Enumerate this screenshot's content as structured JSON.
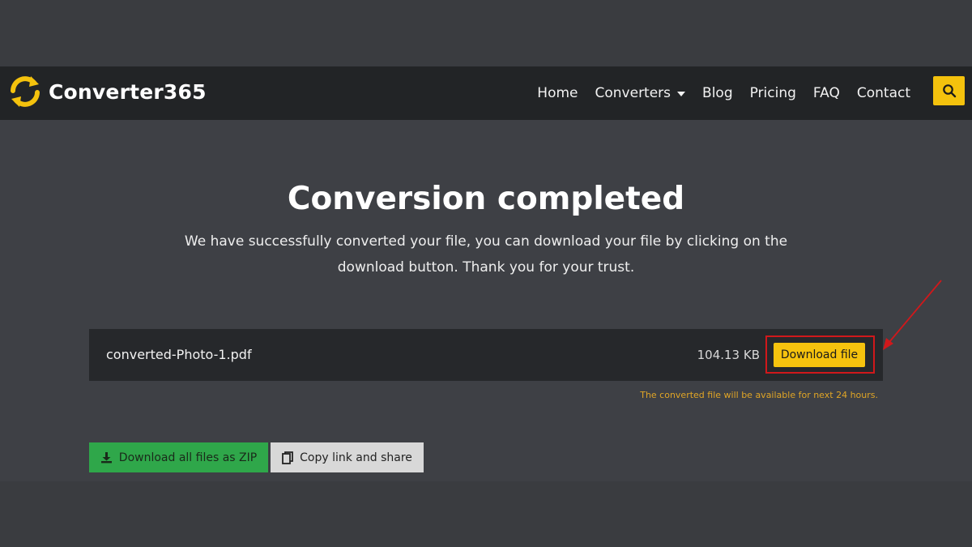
{
  "header": {
    "brand": "Converter365",
    "nav": [
      {
        "label": "Home"
      },
      {
        "label": "Converters",
        "has_dropdown": true
      },
      {
        "label": "Blog"
      },
      {
        "label": "Pricing"
      },
      {
        "label": "FAQ"
      },
      {
        "label": "Contact"
      }
    ],
    "search_icon": "search-icon",
    "accent_color": "#f4c20d"
  },
  "main": {
    "title": "Conversion completed",
    "subtitle": "We have successfully converted your file, you can download your file by clicking on the download button. Thank you for your trust.",
    "file": {
      "name": "converted-Photo-1.pdf",
      "size": "104.13 KB",
      "download_label": "Download file"
    },
    "availability_note": "The converted file will be available for next 24 hours.",
    "actions": {
      "zip_label": "Download all files as ZIP",
      "zip_icon": "download-icon",
      "share_label": "Copy link and share",
      "share_icon": "copy-icon"
    }
  },
  "annotation": {
    "highlight_color": "#d0181b"
  }
}
